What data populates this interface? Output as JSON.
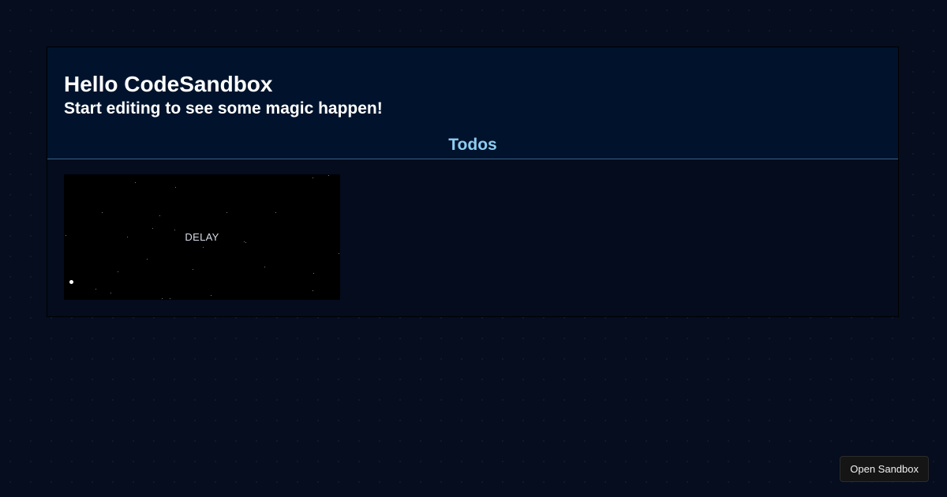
{
  "app": {
    "title": "Hello CodeSandbox",
    "subtitle": "Start editing to see some magic happen!"
  },
  "todos": {
    "heading": "Todos",
    "items": [
      {
        "label": "DELAY"
      }
    ]
  },
  "footer": {
    "open_sandbox_label": "Open Sandbox"
  }
}
